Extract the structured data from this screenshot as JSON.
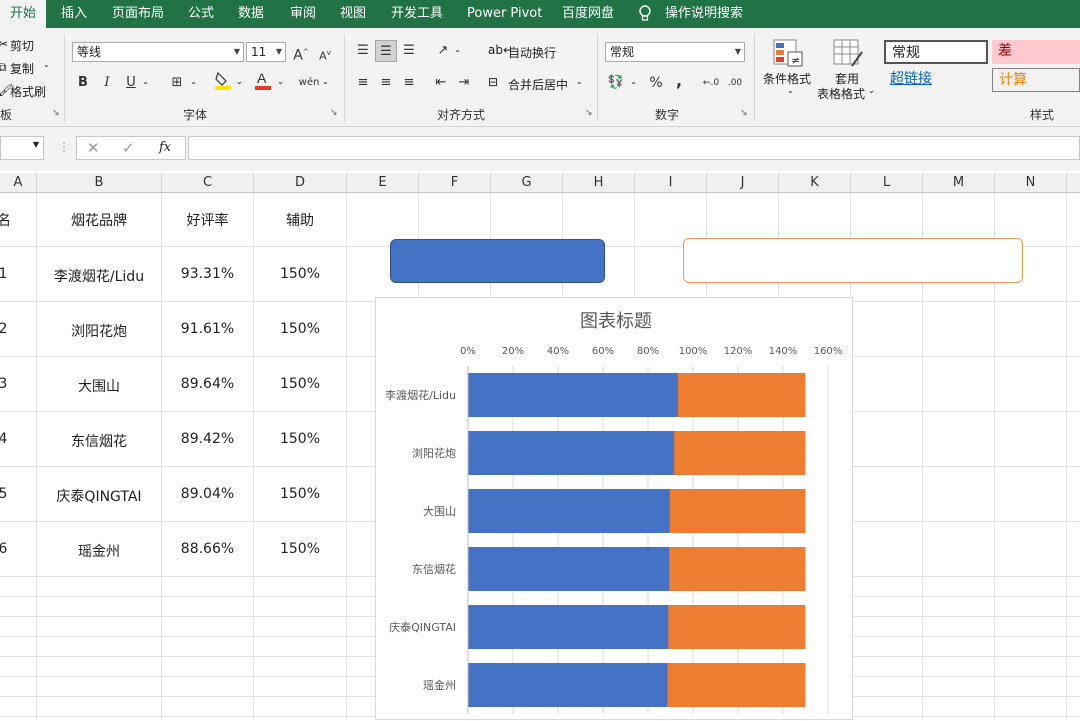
{
  "ribbon": {
    "tabs": [
      "开始",
      "插入",
      "页面布局",
      "公式",
      "数据",
      "审阅",
      "视图",
      "开发工具",
      "Power Pivot",
      "百度网盘"
    ],
    "tell_me": "操作说明搜索",
    "clipboard": {
      "cut": "剪切",
      "copy": "复制",
      "format_painter": "格式刷",
      "group": "板"
    },
    "font": {
      "name": "等线",
      "size": "11",
      "group": "字体",
      "bold": "B",
      "italic": "I",
      "underline": "U",
      "grow": "A",
      "shrink": "A"
    },
    "alignment": {
      "wrap": "自动换行",
      "merge": "合并后居中",
      "group": "对齐方式"
    },
    "number": {
      "format": "常规",
      "percent": "%",
      "comma": ",",
      "group": "数字"
    },
    "styles": {
      "conditional": "条件格式",
      "table_line1": "套用",
      "table_line2": "表格格式",
      "normal": "常规",
      "bad": "差",
      "hyperlink": "超链接",
      "calc": "计算",
      "group": "样式"
    },
    "colors": {
      "accent": "#217346",
      "bad_bg": "#ffc7ce",
      "bad_fg": "#9c0006",
      "calc_fg": "#fa7d00",
      "link": "#0563c1"
    }
  },
  "formula_bar": {
    "cancel": "✕",
    "enter": "✓",
    "fx": "fx",
    "value": ""
  },
  "sheet": {
    "columns": [
      "A",
      "B",
      "C",
      "D",
      "E",
      "F",
      "G",
      "H",
      "I",
      "J",
      "K",
      "L",
      "M",
      "N"
    ],
    "headers": [
      "名",
      "烟花品牌",
      "好评率",
      "辅助"
    ],
    "rows": [
      {
        "rank": "1",
        "brand": "李渡烟花/Lidu",
        "rate": "93.31%",
        "aux": "150%"
      },
      {
        "rank": "2",
        "brand": "浏阳花炮",
        "rate": "91.61%",
        "aux": "150%"
      },
      {
        "rank": "3",
        "brand": "大围山",
        "rate": "89.64%",
        "aux": "150%"
      },
      {
        "rank": "4",
        "brand": "东信烟花",
        "rate": "89.42%",
        "aux": "150%"
      },
      {
        "rank": "5",
        "brand": "庆泰QINGTAI",
        "rate": "89.04%",
        "aux": "150%"
      },
      {
        "rank": "6",
        "brand": "瑶金州",
        "rate": "88.66%",
        "aux": "150%"
      }
    ]
  },
  "chart_data": {
    "type": "bar",
    "title": "图表标题",
    "orientation": "horizontal",
    "categories": [
      "李渡烟花/Lidu",
      "浏阳花炮",
      "大围山",
      "东信烟花",
      "庆泰QINGTAI",
      "瑶金州"
    ],
    "series": [
      {
        "values": [
          93.31,
          91.61,
          89.64,
          89.42,
          89.04,
          88.66
        ],
        "color": "#4472c4"
      },
      {
        "values": [
          150,
          150,
          150,
          150,
          150,
          150
        ],
        "color": "#ed7d31"
      }
    ],
    "xlim": [
      0,
      160
    ],
    "xticks": [
      "0%",
      "20%",
      "40%",
      "60%",
      "80%",
      "100%",
      "120%",
      "140%",
      "160%"
    ],
    "grid": true,
    "legend": "none"
  }
}
